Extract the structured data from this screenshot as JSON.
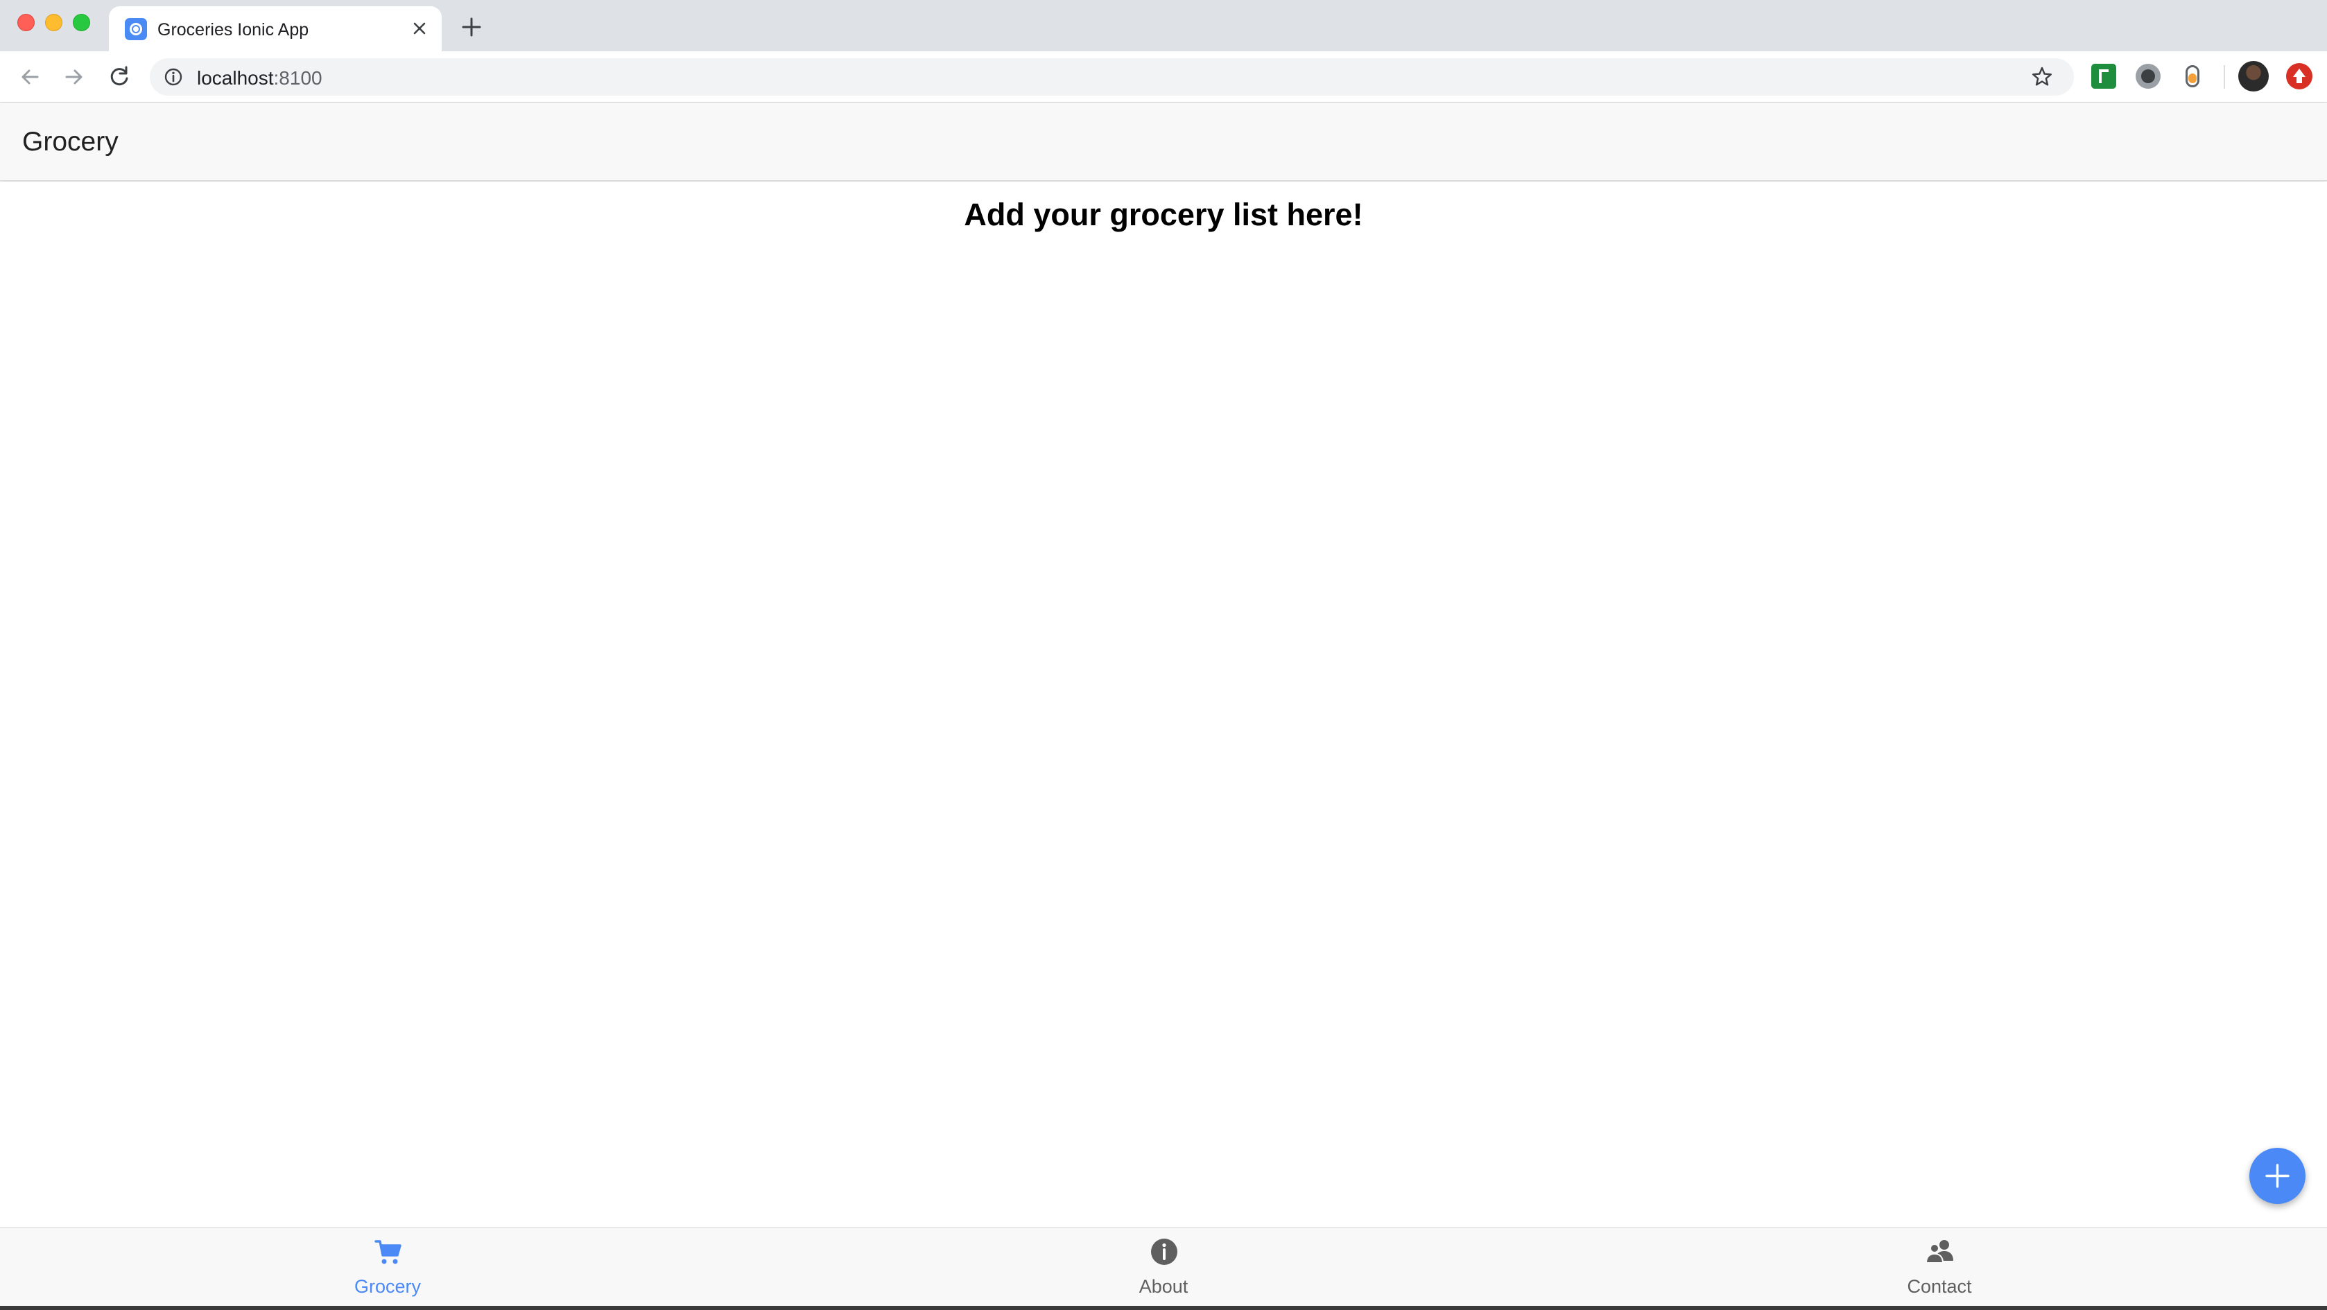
{
  "browser": {
    "tab_title": "Groceries Ionic App",
    "url_host": "localhost",
    "url_port": ":8100"
  },
  "app": {
    "header_title": "Grocery",
    "heading": "Add your grocery list here!",
    "accent_color": "#4b8af6"
  },
  "tabbar": {
    "tabs": [
      {
        "label": "Grocery",
        "icon": "cart-icon",
        "active": true
      },
      {
        "label": "About",
        "icon": "info-icon",
        "active": false
      },
      {
        "label": "Contact",
        "icon": "people-icon",
        "active": false
      }
    ]
  },
  "fab": {
    "icon": "plus-icon"
  }
}
